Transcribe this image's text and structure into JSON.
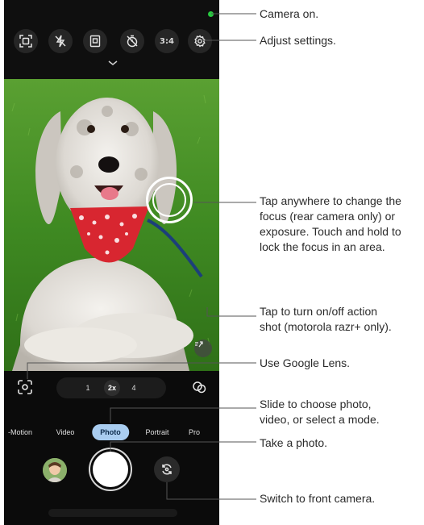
{
  "topbar": {
    "buttons": [
      {
        "icon": "scan-frame-icon"
      },
      {
        "icon": "flash-off-icon"
      },
      {
        "icon": "photo-format-icon"
      },
      {
        "icon": "timer-off-icon"
      },
      {
        "icon": "aspect-ratio-icon",
        "label": "3:4"
      },
      {
        "icon": "settings-icon"
      }
    ],
    "expand_icon": "chevron-down-icon",
    "indicator_color": "#27c93f"
  },
  "zoom": {
    "options": [
      "1",
      "2x",
      "4"
    ],
    "selected": "2x"
  },
  "modes": {
    "items": [
      "-Motion",
      "Video",
      "Photo",
      "Portrait",
      "Pro"
    ],
    "selected": "Photo"
  },
  "callouts": {
    "camera_on": "Camera on.",
    "adjust_settings": "Adjust settings.",
    "focus": [
      "Tap anywhere to change the",
      "focus (rear camera only) or",
      "exposure. Touch and hold to",
      "lock the focus in an area."
    ],
    "action_shot": [
      "Tap to turn on/off action",
      "shot (motorola razr+ only)."
    ],
    "google_lens": "Use Google Lens.",
    "slide_mode": [
      "Slide to choose photo,",
      "video, or select a mode."
    ],
    "take_photo": "Take a photo.",
    "switch_camera": "Switch to front camera."
  },
  "colors": {
    "mode_highlight": "#a9cdf0",
    "callout_line": "#555555"
  }
}
